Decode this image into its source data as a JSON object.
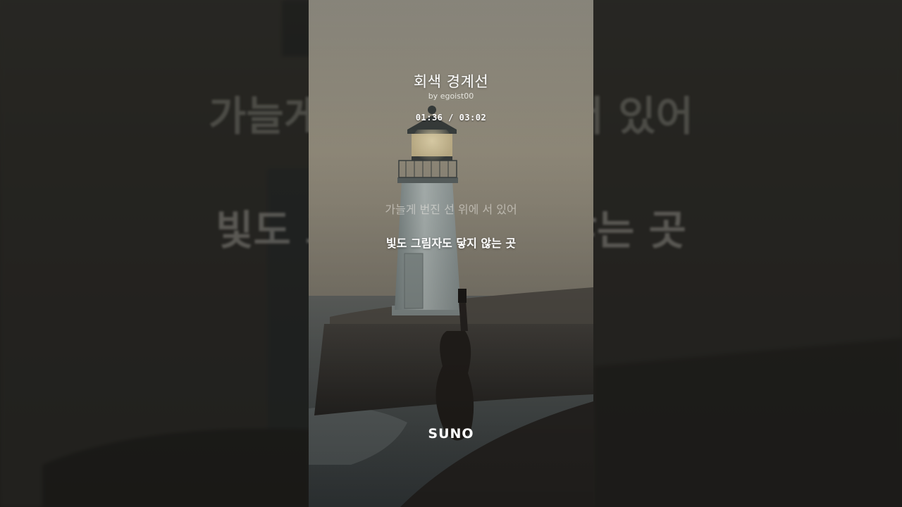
{
  "song": {
    "title": "회색 경계선",
    "artist": "by egoist00",
    "time_current": "01:36",
    "time_separator": "/",
    "time_total": "03:02"
  },
  "lyrics": {
    "previous": "가늘게 번진 선 위에 서 있어",
    "current": "빛도 그림자도 닿지 않는 곳"
  },
  "background_lyrics": {
    "line1": "가늘게 번진 선 위에 서 있어",
    "line2": "빛도 그림자도 닿지 않는 곳"
  },
  "brand": {
    "name": "SUNO"
  },
  "artwork": {
    "subject": "lighthouse-on-pier-with-guitar",
    "sky_color": "#9a9385",
    "sea_color": "#4f5658",
    "pier_color": "#3a3733",
    "lighthouse_color": "#a9b3b1"
  }
}
